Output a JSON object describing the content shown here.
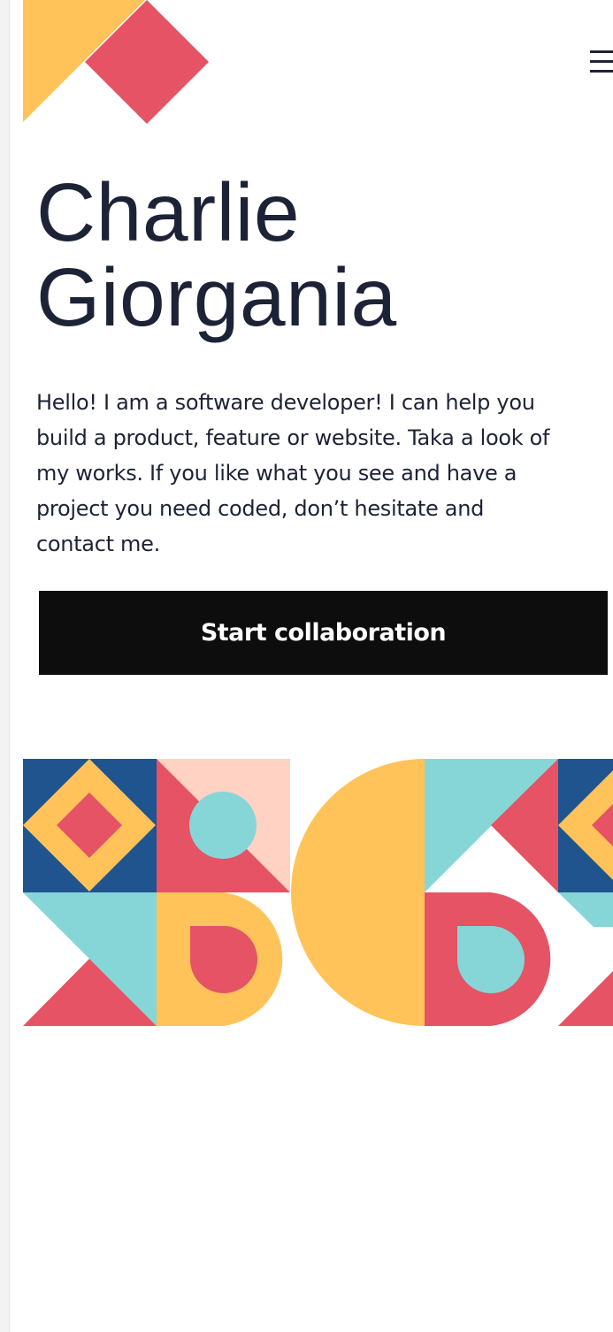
{
  "header": {
    "logo_icon": "geometric-logo-icon",
    "menu_icon": "hamburger-menu-icon"
  },
  "hero": {
    "name_line1": "Charlie",
    "name_line2": "Giorgania",
    "intro": "Hello! I am a software developer! I can help you build a product, feature or website. Taka a look of my works. If you like what you see and have a project you need coded, don’t hesitate and contact me.",
    "cta_label": "Start collaboration"
  },
  "colors": {
    "yellow": "#ffc35a",
    "red": "#e55364",
    "navy": "#1f548f",
    "teal": "#86d6d8",
    "peach": "#ffd2c4",
    "text": "#1d2336",
    "button": "#0d0d0d"
  }
}
